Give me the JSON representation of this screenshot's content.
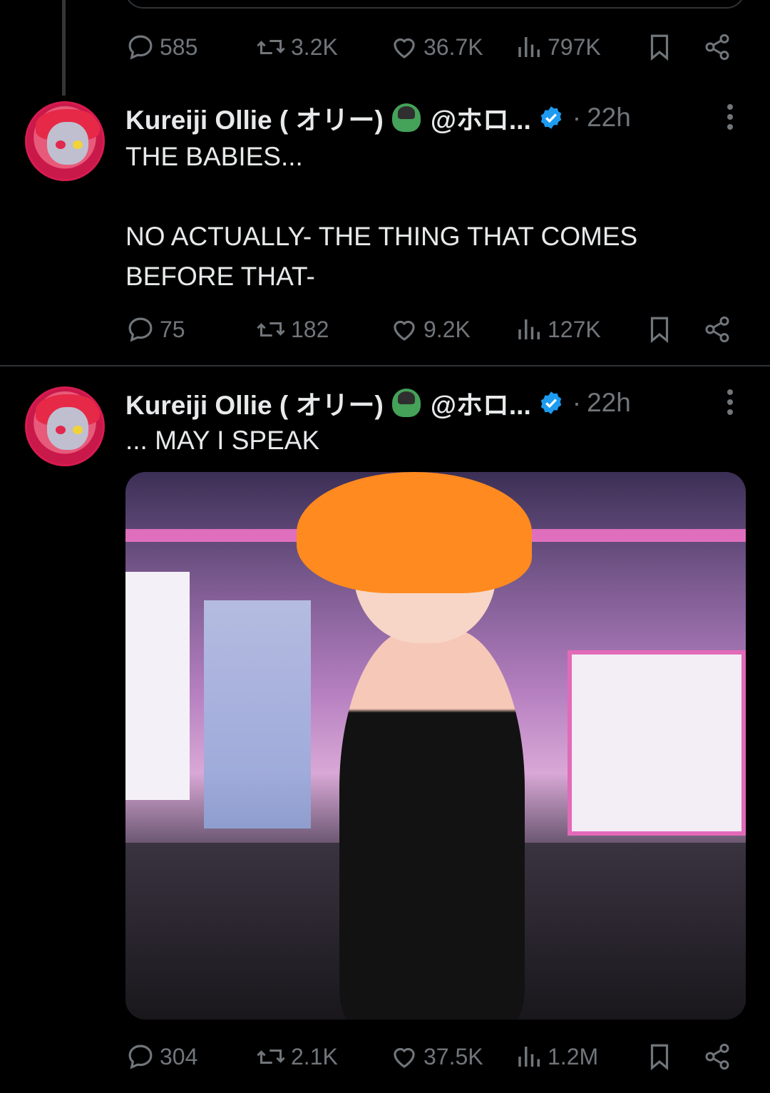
{
  "previous_tweet": {
    "actions": {
      "replies": "585",
      "reposts": "3.2K",
      "likes": "36.7K",
      "views": "797K"
    }
  },
  "tweets": [
    {
      "author_name": "Kureiji Ollie ( オリー)",
      "author_emoji": "zombie-woman-icon",
      "handle": "@ホロ...",
      "separator": "·",
      "time": "22h",
      "text_lines": [
        "THE BABIES...",
        "",
        "NO ACTUALLY- THE THING THAT COMES",
        "BEFORE THAT-"
      ],
      "actions": {
        "replies": "75",
        "reposts": "182",
        "likes": "9.2K",
        "views": "127K"
      }
    },
    {
      "author_name": "Kureiji Ollie ( オリー)",
      "author_emoji": "zombie-woman-icon",
      "handle": "@ホロ...",
      "separator": "·",
      "time": "22h",
      "text_lines": [
        "... MAY I SPEAK"
      ],
      "media": "anime-character-image",
      "actions": {
        "replies": "304",
        "reposts": "2.1K",
        "likes": "37.5K",
        "views": "1.2M"
      }
    }
  ],
  "colors": {
    "background": "#000000",
    "text": "#e7e9ea",
    "muted": "#71767b",
    "divider": "#2f3336",
    "verified": "#1d9bf0"
  }
}
